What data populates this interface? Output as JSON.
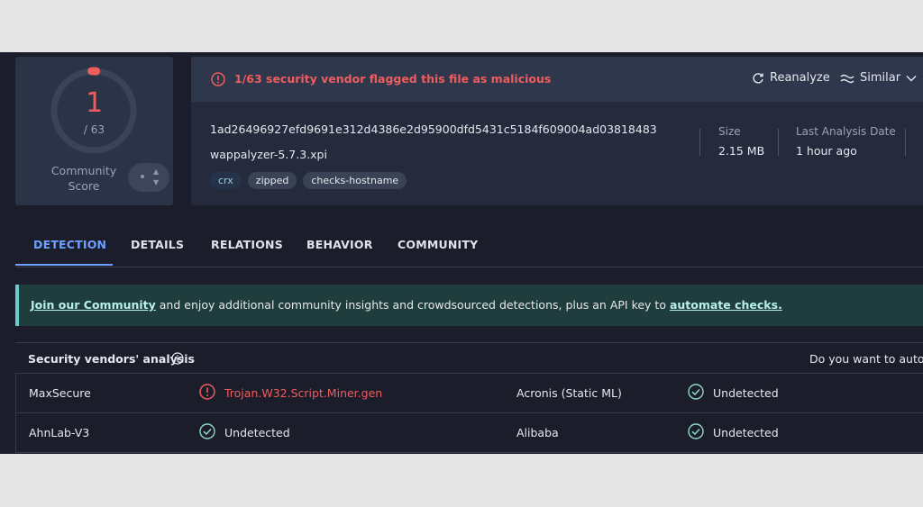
{
  "score": {
    "detected": "1",
    "total": "/ 63",
    "ratio": 0.0159,
    "label": "Community Score",
    "label_line1": "Community",
    "label_line2": "Score"
  },
  "file": {
    "alert": "1/63 security vendor flagged this file as malicious",
    "reanalyze": "Reanalyze",
    "similar": "Similar",
    "hash": "1ad26496927efd9691e312d4386e2d95900dfd5431c5184f609004ad03818483",
    "name": "wappalyzer-5.7.3.xpi",
    "tags": [
      "crx",
      "zipped",
      "checks-hostname"
    ],
    "size_label": "Size",
    "size_value": "2.15 MB",
    "date_label": "Last Analysis Date",
    "date_value": "1 hour ago"
  },
  "tabs": [
    "DETECTION",
    "DETAILS",
    "RELATIONS",
    "BEHAVIOR",
    "COMMUNITY"
  ],
  "banner": {
    "link1": "Join our Community",
    "middle": " and enjoy additional community insights and crowdsourced detections, plus an API key to ",
    "link2": "automate checks."
  },
  "analysis": {
    "title": "Security vendors' analysis",
    "automate": "Do you want to autom",
    "rows": [
      {
        "vendor1": "MaxSecure",
        "result1": "Trojan.W32.Script.Miner.gen",
        "status1": "malicious",
        "vendor2": "Acronis (Static ML)",
        "result2": "Undetected",
        "status2": "clean"
      },
      {
        "vendor1": "AhnLab-V3",
        "result1": "Undetected",
        "status1": "clean",
        "vendor2": "Alibaba",
        "result2": "Undetected",
        "status2": "clean"
      }
    ]
  },
  "colors": {
    "malicious": "#ee5d5d",
    "clean": "#8fd8c5",
    "accent": "#6ea0ff",
    "banner_bg": "#1f3d3d"
  },
  "icons": [
    "alert-circle-icon",
    "refresh-icon",
    "similar-icon",
    "chevron-down-icon",
    "info-icon",
    "check-circle-icon",
    "arrow-up-icon",
    "arrow-down-icon"
  ]
}
